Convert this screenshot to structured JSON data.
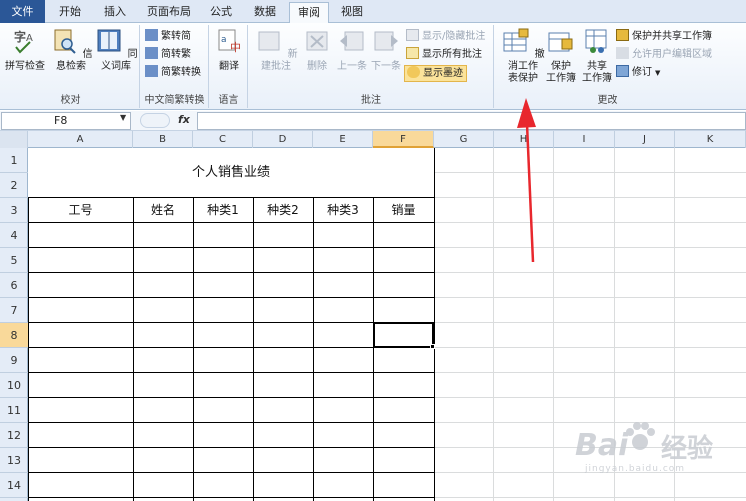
{
  "tabs": [
    "文件",
    "开始",
    "插入",
    "页面布局",
    "公式",
    "数据",
    "审阅",
    "视图"
  ],
  "ribbon": {
    "proofing": {
      "label": "校对",
      "buttons": [
        "拼写检查",
        "信息检索",
        "同义词库"
      ]
    },
    "chinese": {
      "label": "中文简繁转换",
      "buttons": [
        "繁转简",
        "简转繁",
        "简繁转换"
      ]
    },
    "language": {
      "label": "语言",
      "buttons": [
        "翻译"
      ]
    },
    "comments": {
      "label": "批注",
      "buttons": [
        "新建批注",
        "删除",
        "上一条",
        "下一条"
      ],
      "side": [
        "显示/隐藏批注",
        "显示所有批注",
        "显示墨迹"
      ]
    },
    "changes": {
      "label": "更改",
      "big": [
        [
          "撤消工作",
          "表保护"
        ],
        [
          "保护",
          "工作簿"
        ],
        [
          "共享",
          "工作簿"
        ]
      ],
      "side": [
        "保护并共享工作簿",
        "允许用户编辑区域",
        "修订"
      ]
    }
  },
  "formula": {
    "namebox": "F8",
    "fx": "fx",
    "content": ""
  },
  "columns": [
    "A",
    "B",
    "C",
    "D",
    "E",
    "F",
    "G",
    "H",
    "I",
    "J",
    "K"
  ],
  "rows": [
    "1",
    "2",
    "3",
    "4",
    "5",
    "6",
    "7",
    "8",
    "9",
    "10",
    "11",
    "12",
    "13",
    "14"
  ],
  "sheet": {
    "title": "个人销售业绩",
    "headers": [
      "工号",
      "姓名",
      "种类1",
      "种类2",
      "种类3",
      "销量"
    ]
  },
  "watermark": {
    "brand_left": "Bai",
    "brand_right": "经验",
    "url": "jingyan.baidu.com"
  },
  "colors": {
    "file_tab": "#2b5797",
    "selected_header": "#f9d99a",
    "arrow": "#e8272d",
    "highlight_button": "#fbe39a"
  }
}
